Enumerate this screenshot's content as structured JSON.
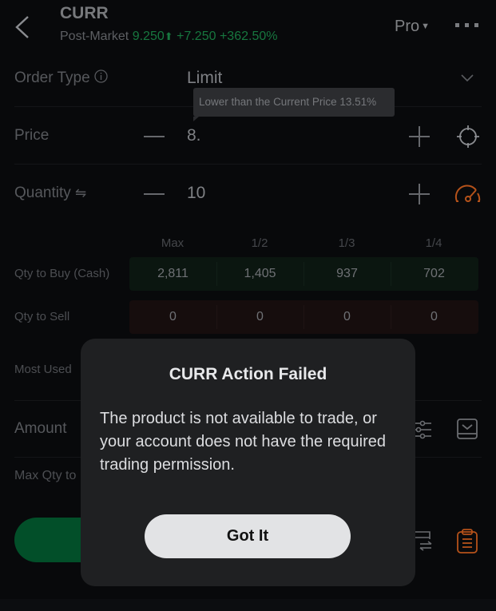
{
  "header": {
    "symbol": "CURR",
    "session_label": "Post-Market",
    "price": "9.250",
    "direction": "up",
    "change": "+7.250",
    "change_pct": "+362.50%",
    "mode": "Pro",
    "colors": {
      "up": "#17773f",
      "accent_orange": "#b5521a",
      "buy_green": "#024f29"
    }
  },
  "order_type": {
    "label": "Order Type",
    "value": "Limit"
  },
  "tooltip": {
    "text": "Lower than the Current Price 13.51%"
  },
  "price": {
    "label": "Price",
    "value": "8."
  },
  "quantity": {
    "label": "Quantity",
    "value": "10"
  },
  "qty_table": {
    "columns": [
      "Max",
      "1/2",
      "1/3",
      "1/4"
    ],
    "rows": [
      {
        "label": "Qty to Buy (Cash)",
        "values": [
          "2,811",
          "1,405",
          "937",
          "702"
        ]
      },
      {
        "label": "Qty to Sell",
        "values": [
          "0",
          "0",
          "0",
          "0"
        ]
      }
    ]
  },
  "most_used": {
    "label": "Most Used"
  },
  "amount": {
    "label": "Amount"
  },
  "max_qty": {
    "label": "Max Qty to"
  },
  "modal": {
    "title": "CURR Action Failed",
    "body": "The product is not available to trade, or your account does not have the required trading permission.",
    "button": "Got It"
  }
}
